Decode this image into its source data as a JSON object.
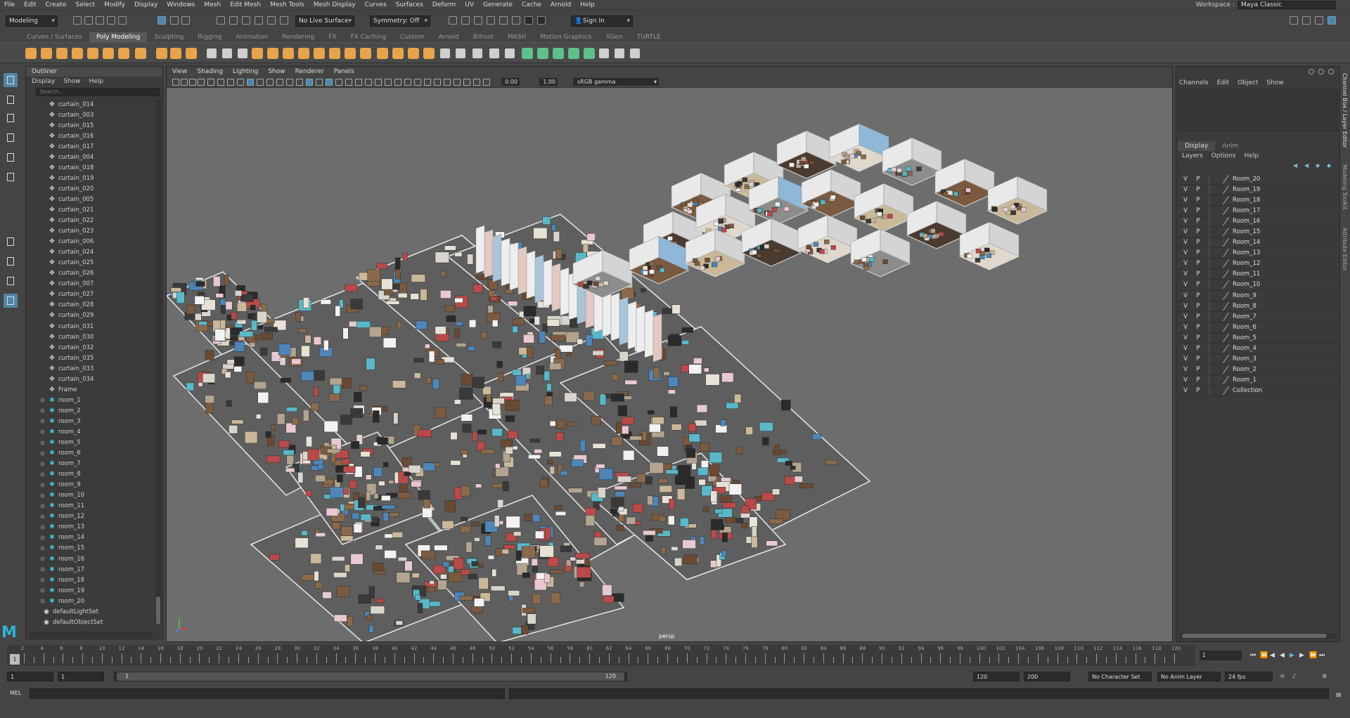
{
  "menubar": {
    "items": [
      "File",
      "Edit",
      "Create",
      "Select",
      "Modify",
      "Display",
      "Windows",
      "Mesh",
      "Edit Mesh",
      "Mesh Tools",
      "Mesh Display",
      "Curves",
      "Surfaces",
      "Deform",
      "UV",
      "Generate",
      "Cache",
      "Arnold",
      "Help"
    ],
    "workspace_label": "Workspace :",
    "workspace_value": "Maya Classic"
  },
  "statusline": {
    "menuset": "Modeling",
    "live_surface": "No Live Surface",
    "symmetry": "Symmetry: Off",
    "sign_in": "Sign In"
  },
  "shelf": {
    "tabs": [
      "Curves / Surfaces",
      "Poly Modeling",
      "Sculpting",
      "Rigging",
      "Animation",
      "Rendering",
      "FX",
      "FX Caching",
      "Custom",
      "Arnold",
      "Bifrost",
      "MASH",
      "Motion Graphics",
      "XGen",
      "TURTLE"
    ],
    "active_tab": "Poly Modeling"
  },
  "outliner": {
    "title": "Outliner",
    "menu": [
      "Display",
      "Show",
      "Help"
    ],
    "search_placeholder": "Search...",
    "items": [
      {
        "name": "curtain_014",
        "type": "mesh"
      },
      {
        "name": "curtain_003",
        "type": "mesh"
      },
      {
        "name": "curtain_015",
        "type": "mesh"
      },
      {
        "name": "curtain_016",
        "type": "mesh"
      },
      {
        "name": "curtain_017",
        "type": "mesh"
      },
      {
        "name": "curtain_004",
        "type": "mesh"
      },
      {
        "name": "curtain_018",
        "type": "mesh"
      },
      {
        "name": "curtain_019",
        "type": "mesh"
      },
      {
        "name": "curtain_020",
        "type": "mesh"
      },
      {
        "name": "curtain_005",
        "type": "mesh"
      },
      {
        "name": "curtain_021",
        "type": "mesh"
      },
      {
        "name": "curtain_022",
        "type": "mesh"
      },
      {
        "name": "curtain_023",
        "type": "mesh"
      },
      {
        "name": "curtain_006",
        "type": "mesh"
      },
      {
        "name": "curtain_024",
        "type": "mesh"
      },
      {
        "name": "curtain_025",
        "type": "mesh"
      },
      {
        "name": "curtain_026",
        "type": "mesh"
      },
      {
        "name": "curtain_007",
        "type": "mesh"
      },
      {
        "name": "curtain_027",
        "type": "mesh"
      },
      {
        "name": "curtain_028",
        "type": "mesh"
      },
      {
        "name": "curtain_029",
        "type": "mesh"
      },
      {
        "name": "curtain_031",
        "type": "mesh"
      },
      {
        "name": "curtain_030",
        "type": "mesh"
      },
      {
        "name": "curtain_032",
        "type": "mesh"
      },
      {
        "name": "curtain_035",
        "type": "mesh"
      },
      {
        "name": "curtain_033",
        "type": "mesh"
      },
      {
        "name": "curtain_034",
        "type": "mesh"
      },
      {
        "name": "Frame",
        "type": "mesh"
      },
      {
        "name": "room_1",
        "type": "transform"
      },
      {
        "name": "room_2",
        "type": "transform"
      },
      {
        "name": "room_3",
        "type": "transform"
      },
      {
        "name": "room_4",
        "type": "transform"
      },
      {
        "name": "room_5",
        "type": "transform"
      },
      {
        "name": "room_6",
        "type": "transform"
      },
      {
        "name": "room_7",
        "type": "transform"
      },
      {
        "name": "room_8",
        "type": "transform"
      },
      {
        "name": "room_9",
        "type": "transform"
      },
      {
        "name": "room_10",
        "type": "transform"
      },
      {
        "name": "room_11",
        "type": "transform"
      },
      {
        "name": "room_12",
        "type": "transform"
      },
      {
        "name": "room_13",
        "type": "transform"
      },
      {
        "name": "room_14",
        "type": "transform"
      },
      {
        "name": "room_15",
        "type": "transform"
      },
      {
        "name": "room_16",
        "type": "transform"
      },
      {
        "name": "room_17",
        "type": "transform"
      },
      {
        "name": "room_18",
        "type": "transform"
      },
      {
        "name": "room_19",
        "type": "transform"
      },
      {
        "name": "room_20",
        "type": "transform"
      },
      {
        "name": "defaultLightSet",
        "type": "set"
      },
      {
        "name": "defaultObjectSet",
        "type": "set"
      }
    ]
  },
  "viewport": {
    "menu": [
      "View",
      "Shading",
      "Lighting",
      "Show",
      "Renderer",
      "Panels"
    ],
    "exposure": "0.00",
    "gamma": "1.00",
    "color_space": "sRGB gamma",
    "camera": "persp"
  },
  "channelbox": {
    "menu": [
      "Channels",
      "Edit",
      "Object",
      "Show"
    ],
    "tabs": [
      "Display",
      "Anim"
    ],
    "active_tab": "Display",
    "layer_menu": [
      "Layers",
      "Options",
      "Help"
    ],
    "layers": [
      "Room_20",
      "Room_19",
      "Room_18",
      "Room_17",
      "Room_16",
      "Room_15",
      "Room_14",
      "Room_13",
      "Room_12",
      "Room_11",
      "Room_10",
      "Room_9",
      "Room_8",
      "Room_7",
      "Room_6",
      "Room_5",
      "Room_4",
      "Room_3",
      "Room_2",
      "Room_1",
      "Collection"
    ],
    "v_label": "V",
    "p_label": "P"
  },
  "side_tabs": [
    "Channel Box / Layer Editor",
    "Modeling Toolkit",
    "Attribute Editor"
  ],
  "timeslider": {
    "ticks": [
      1,
      2,
      3,
      4,
      5,
      6,
      7,
      8,
      9,
      10,
      11,
      12,
      13,
      14,
      15,
      16,
      17,
      18,
      19,
      20,
      21,
      22,
      23,
      24,
      25,
      26,
      27,
      28,
      29,
      30,
      31,
      32,
      33,
      34,
      35,
      36,
      37,
      38,
      39,
      40,
      41,
      42,
      43,
      44,
      45,
      46,
      47,
      48,
      49,
      50,
      51,
      52,
      53,
      54,
      55,
      56,
      57,
      58,
      59,
      60,
      61,
      62,
      63,
      64,
      65,
      66,
      67,
      68,
      69,
      70,
      71,
      72,
      73,
      74,
      75,
      76,
      77,
      78,
      79,
      80,
      81,
      82,
      83,
      84,
      85,
      86,
      87,
      88,
      89,
      90,
      91,
      92,
      93,
      94,
      95,
      96,
      97,
      98,
      99,
      100,
      101,
      102,
      103,
      104,
      105,
      106,
      107,
      108,
      109,
      110,
      111,
      112,
      113,
      114,
      115,
      116,
      117,
      118,
      119,
      120
    ],
    "tick_labels": [
      "2",
      "4",
      "6",
      "8",
      "10",
      "12",
      "14",
      "16",
      "18",
      "20",
      "22",
      "24",
      "26",
      "28",
      "30",
      "32",
      "34",
      "36",
      "38",
      "40",
      "42",
      "44",
      "46",
      "48",
      "50",
      "52",
      "54",
      "56",
      "58",
      "60",
      "62",
      "64",
      "66",
      "68",
      "70",
      "72",
      "74",
      "76",
      "78",
      "80",
      "82",
      "84",
      "86",
      "88",
      "90",
      "92",
      "94",
      "96",
      "98",
      "100",
      "102",
      "104",
      "106",
      "108",
      "110",
      "112",
      "114",
      "116",
      "118",
      "120"
    ],
    "current_frame": "1",
    "frame_field": "1"
  },
  "range": {
    "start": "1",
    "playback_start": "1",
    "range_start": "1",
    "range_end": "120",
    "playback_end": "120",
    "end": "200",
    "character_set": "No Character Set",
    "anim_layer": "No Anim Layer",
    "fps": "24 fps"
  },
  "cmdline": {
    "label": "MEL"
  }
}
